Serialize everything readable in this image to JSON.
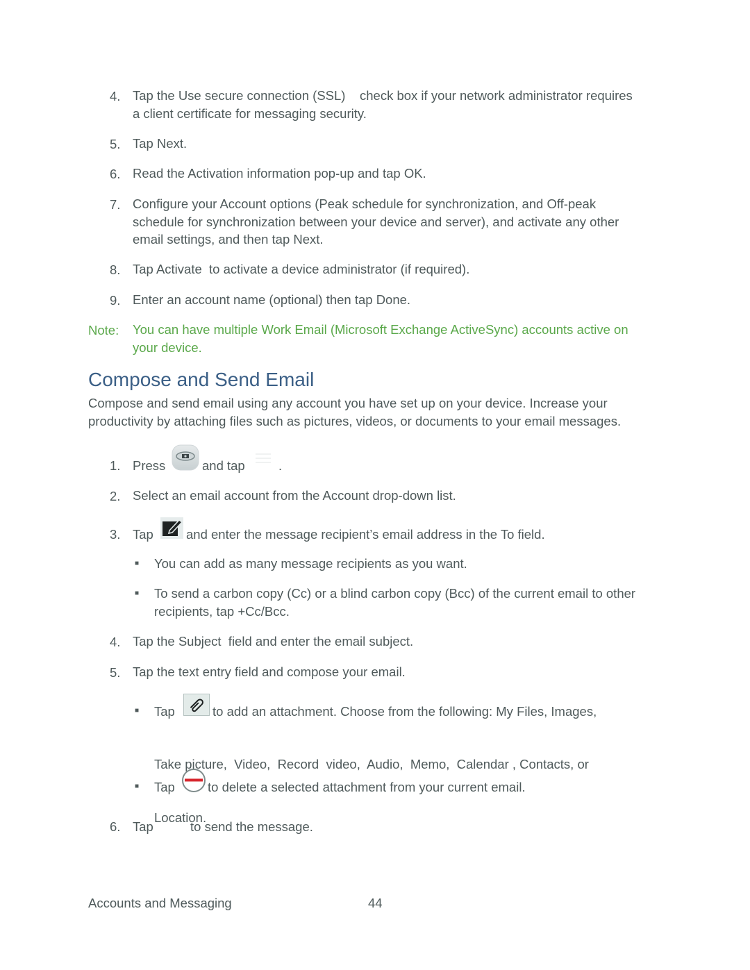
{
  "steps_top": [
    {
      "num": "4.",
      "lines": [
        "Tap the Use secure connection (SSL)    check box if your network administrator requires",
        "a client certificate for messaging security."
      ]
    },
    {
      "num": "5.",
      "lines": [
        "Tap Next."
      ]
    },
    {
      "num": "6.",
      "lines": [
        "Read the Activation information pop-up and tap OK."
      ]
    },
    {
      "num": "7.",
      "lines": [
        "Configure your Account options (Peak schedule for synchronization, and Off-peak",
        "schedule for synchronization between your device and server), and activate any other",
        "email settings, and then tap Next."
      ]
    },
    {
      "num": "8.",
      "lines": [
        "Tap Activate  to activate a device administrator (if required)."
      ]
    },
    {
      "num": "9.",
      "lines": [
        "Enter an account name (optional) then tap Done."
      ]
    }
  ],
  "note": {
    "label": "Note:",
    "lines": [
      "You can have multiple Work Email (Microsoft Exchange ActiveSync) accounts active on",
      "your device."
    ]
  },
  "section": {
    "title": "Compose and Send Email",
    "intro": [
      "Compose and send email using any account you have set up on your device. Increase your",
      "productivity by attaching files such as pictures, videos, or documents to your email messages."
    ]
  },
  "steps": {
    "s1": {
      "num": "1.",
      "before": "Press",
      "middle": "and tap",
      "after": ".",
      "icon1": "home-key-icon",
      "icon2": "menu-icon"
    },
    "s2": {
      "num": "2.",
      "text": "Select an email account from the Account drop-down list."
    },
    "s3": {
      "num": "3.",
      "before": "Tap",
      "after": "and enter the message recipient’s email address in the To field.",
      "icon": "compose-icon"
    },
    "s3_bullets": [
      {
        "lines": [
          "You can add as many message recipients as you want."
        ]
      },
      {
        "lines": [
          "To send a carbon copy (Cc) or a blind carbon copy (Bcc) of the current email to other",
          "recipients, tap +Cc/Bcc."
        ]
      }
    ],
    "s4": {
      "num": "4.",
      "text": "Tap the Subject  field and enter the email subject."
    },
    "s5": {
      "num": "5.",
      "text": "Tap the text entry field and compose your email."
    },
    "s5_b1": {
      "before": "Tap",
      "line1": "to add an attachment. Choose from the following: My Files,  Images,",
      "line2": "Take picture,  Video,  Record  video,  Audio,  Memo,  Calendar , Contacts, or",
      "line3": "Location.",
      "icon": "paperclip-icon"
    },
    "s5_b2": {
      "before": "Tap",
      "after": "to delete a selected attachment from your current email.",
      "icon": "remove-icon"
    },
    "s6": {
      "num": "6.",
      "before": "Tap",
      "after": "to send the message."
    }
  },
  "footer": {
    "section": "Accounts and Messaging",
    "page": "44"
  },
  "colors": {
    "heading": "#3b5f86",
    "note": "#5aa84a",
    "body": "#4f5a5b",
    "remove_red": "#d7282f"
  }
}
